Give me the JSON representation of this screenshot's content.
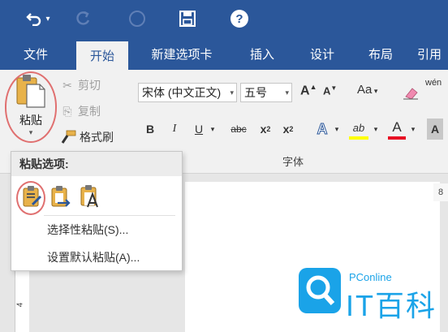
{
  "qat": {
    "undo_caret": "▾",
    "help": "?"
  },
  "tabs": [
    {
      "label": "文件"
    },
    {
      "label": "开始"
    },
    {
      "label": "新建选项卡"
    },
    {
      "label": "插入"
    },
    {
      "label": "设计"
    },
    {
      "label": "布局"
    },
    {
      "label": "引用"
    }
  ],
  "clipboard": {
    "paste_label": "粘贴",
    "cut_label": "剪切",
    "copy_label": "复制",
    "format_painter_label": "格式刷"
  },
  "font": {
    "font_name": "宋体 (中文正文)",
    "font_size": "五号",
    "group_label": "字体",
    "grow": "A",
    "shrink": "A",
    "case": "Aa",
    "phonetic": "wén",
    "bold": "B",
    "italic": "I",
    "underline": "U",
    "strike": "abc",
    "subscript_base": "x",
    "subscript": "2",
    "superscript_base": "x",
    "superscript": "2",
    "text_effect": "A",
    "highlight": "ab",
    "font_color": "A",
    "shading": "A"
  },
  "paste_menu": {
    "header": "粘贴选项:",
    "items": [
      {
        "label": "选择性粘贴(S)..."
      },
      {
        "label": "设置默认粘贴(A)..."
      }
    ]
  },
  "ruler": {
    "vertical_number": "4",
    "horizontal_mark": "8"
  },
  "watermark": {
    "small": "PConline",
    "big": "IT百科"
  },
  "colors": {
    "ribbon_blue": "#2b579a",
    "highlight_red": "#e07070",
    "watermark_blue": "#1aa3e8"
  }
}
